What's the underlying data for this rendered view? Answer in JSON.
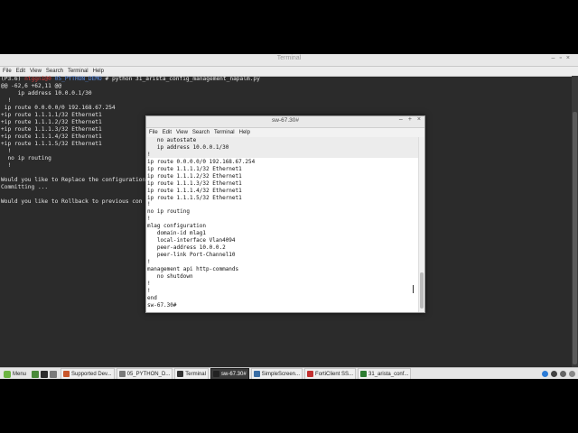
{
  "background_terminal": {
    "title": "Terminal",
    "menu": [
      "File",
      "Edit",
      "View",
      "Search",
      "Terminal",
      "Help"
    ],
    "prompt": {
      "env": "(P3.6) ",
      "user": "ntggn1@0",
      "path": "05_PYTHON_DEMO",
      "symbol": " # ",
      "command": "python 31_arista_config_management_napalm.py"
    },
    "lines": [
      "@@ -62,6 +62,11 @@",
      "     ip address 10.0.0.1/30",
      "  !",
      " ip route 0.0.0.0/0 192.168.67.254",
      "+ip route 1.1.1.1/32 Ethernet1",
      "+ip route 1.1.1.2/32 Ethernet1",
      "+ip route 1.1.1.3/32 Ethernet1",
      "+ip route 1.1.1.4/32 Ethernet1",
      "+ip route 1.1.1.5/32 Ethernet1",
      "  !",
      "  no ip routing",
      "  !",
      "",
      "Would you like to Replace the configuration",
      "Committing ...",
      "",
      "Would you like to Rollback to previous con"
    ]
  },
  "foreground_terminal": {
    "title": "sw-67.30#",
    "menu": [
      "File",
      "Edit",
      "View",
      "Search",
      "Terminal",
      "Help"
    ],
    "lines": [
      "   no autostate",
      "   ip address 10.0.0.1/30",
      "!",
      "ip route 0.0.0.0/0 192.168.67.254",
      "ip route 1.1.1.1/32 Ethernet1",
      "ip route 1.1.1.2/32 Ethernet1",
      "ip route 1.1.1.3/32 Ethernet1",
      "ip route 1.1.1.4/32 Ethernet1",
      "ip route 1.1.1.5/32 Ethernet1",
      "!",
      "no ip routing",
      "!",
      "mlag configuration",
      "   domain-id mlag1",
      "   local-interface Vlan4094",
      "   peer-address 10.0.0.2",
      "   peer-link Port-Channel10",
      "!",
      "management api http-commands",
      "   no shutdown",
      "!",
      "!",
      "end",
      "sw-67.30#"
    ]
  },
  "taskbar": {
    "menu_label": "Menu",
    "tasks": [
      {
        "label": "Supported Dev...",
        "color": "#c9572c"
      },
      {
        "label": "05_PYTHON_D...",
        "color": "#7a7a7a"
      },
      {
        "label": "Terminal",
        "color": "#333333"
      },
      {
        "label": "sw-67.30#",
        "color": "#222222",
        "active": true
      },
      {
        "label": "SimpleScreen...",
        "color": "#3a6ea5"
      },
      {
        "label": "FortiClient SS...",
        "color": "#c23030"
      },
      {
        "label": "31_arista_conf...",
        "color": "#2e7d32"
      }
    ],
    "tray_colors": [
      "#2b7bd6",
      "#444444",
      "#666666",
      "#888888"
    ]
  }
}
